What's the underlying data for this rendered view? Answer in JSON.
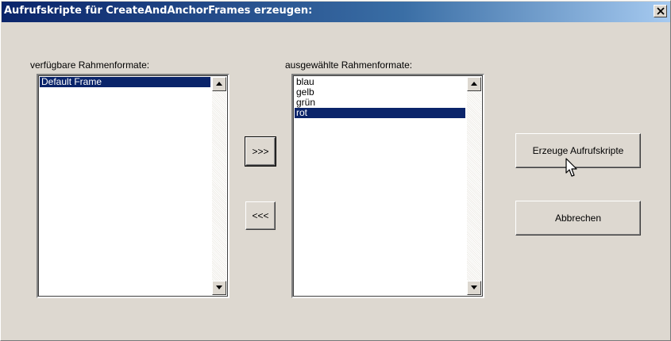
{
  "window": {
    "title": "Aufrufskripte für CreateAndAnchorFrames erzeugen:",
    "close_symbol": "✕"
  },
  "available": {
    "label": "verfügbare Rahmenformate:",
    "items": [
      "Default Frame"
    ],
    "selected_index": 0
  },
  "selected": {
    "label": "ausgewählte Rahmenformate:",
    "items": [
      "blau",
      "gelb",
      "grün",
      "rot"
    ],
    "selected_index": 3
  },
  "buttons": {
    "move_right": ">>>",
    "move_left": "<<<",
    "generate": "Erzeuge Aufrufskripte",
    "cancel": "Abbrechen"
  },
  "icons": {
    "close": "close-icon",
    "scroll_up": "arrow-up-icon",
    "scroll_down": "arrow-down-icon",
    "cursor": "mouse-pointer-icon"
  },
  "colors": {
    "titlebar_start": "#0a246a",
    "titlebar_end": "#a6caf0",
    "selection": "#0a246a",
    "dialog_bg": "#ddd8d0"
  }
}
